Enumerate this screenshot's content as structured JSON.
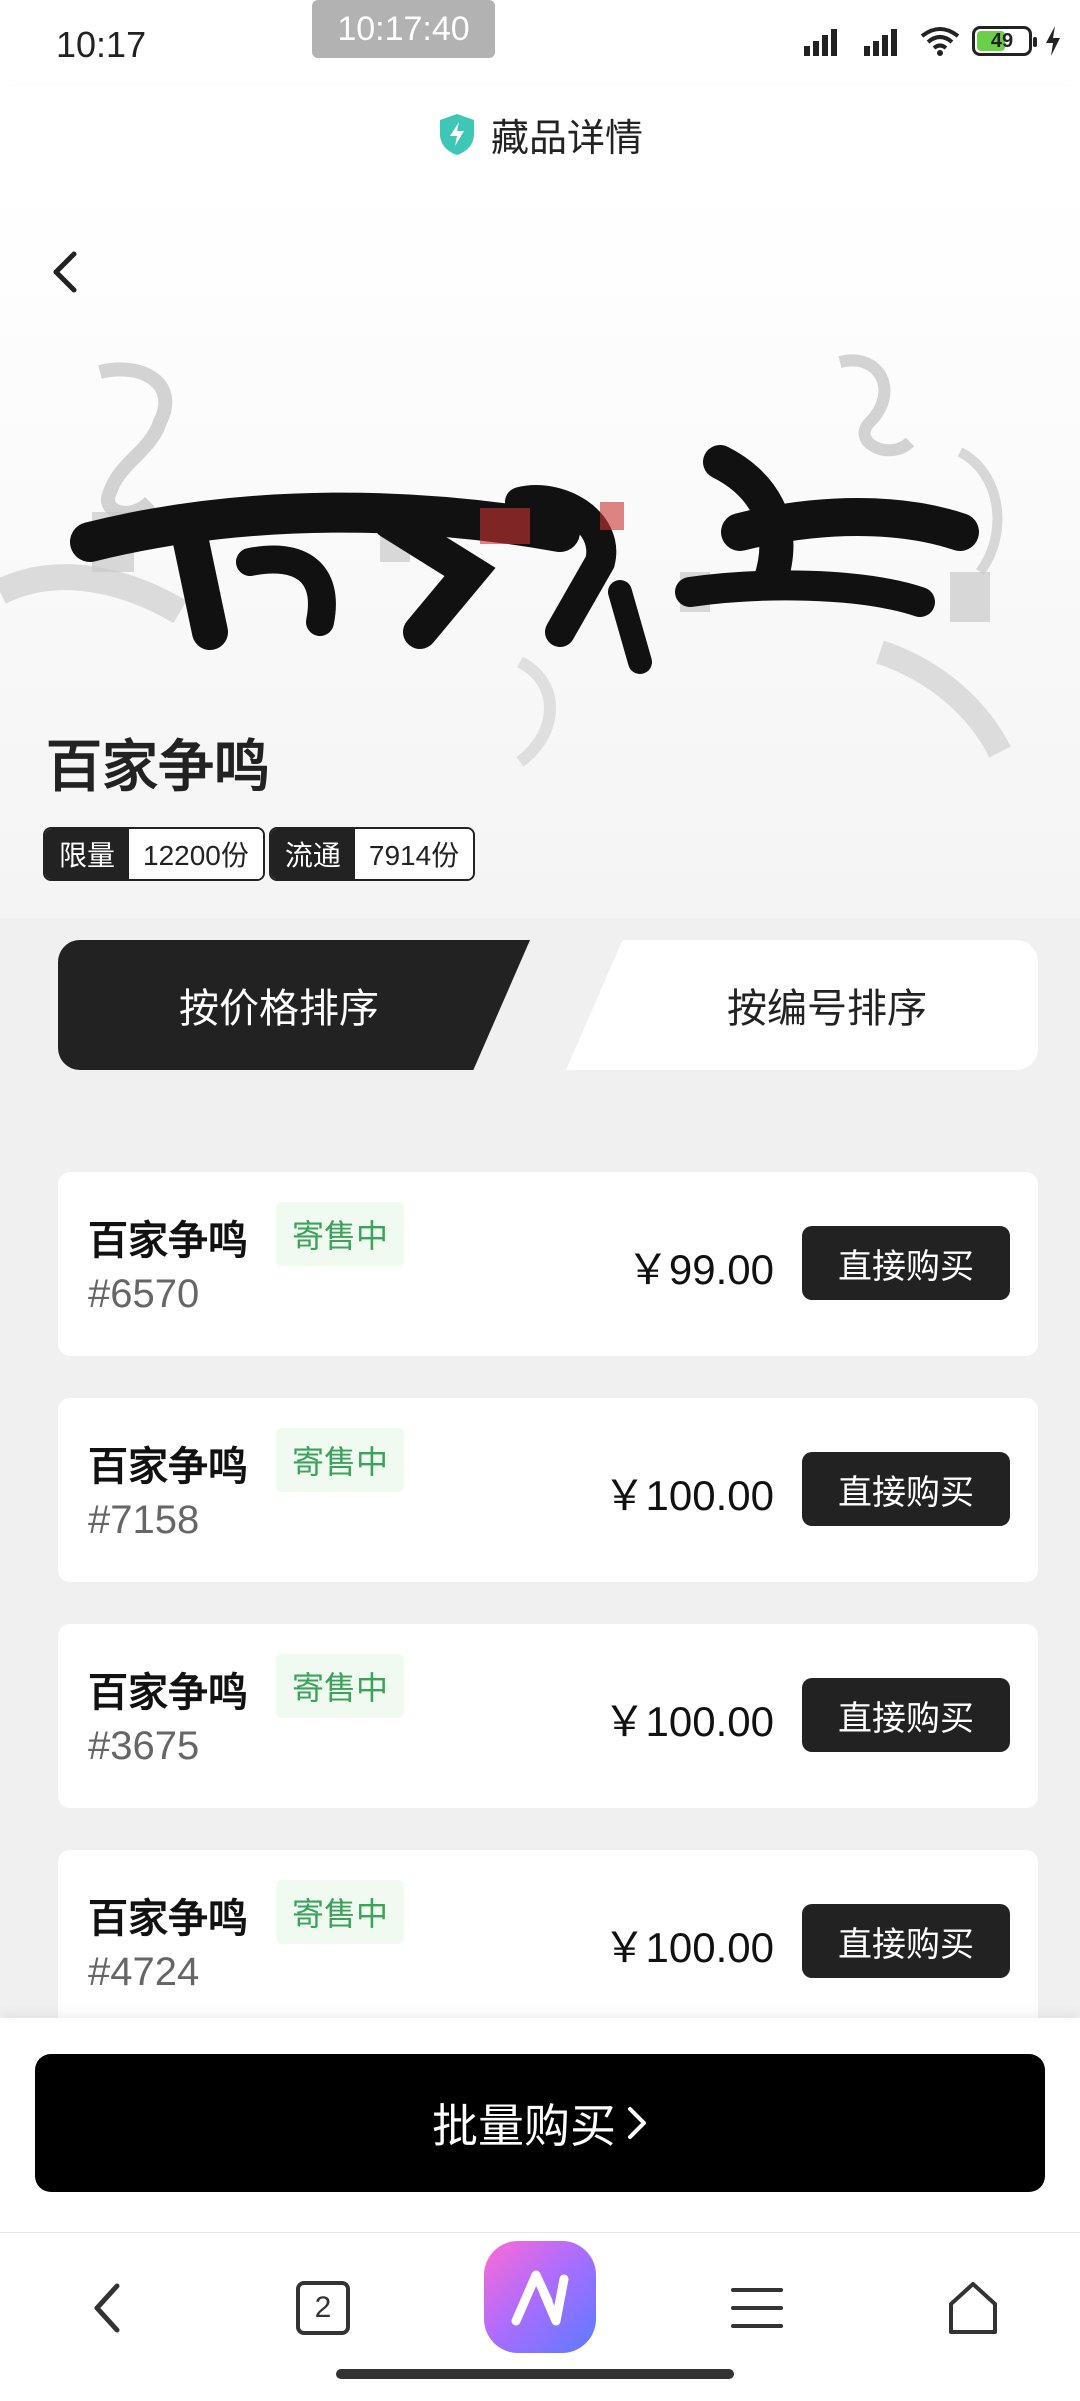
{
  "status_bar": {
    "time": "10:17",
    "toast_time": "10:17:40",
    "battery": "49"
  },
  "header": {
    "title": "藏品详情"
  },
  "collection": {
    "name": "百家争鸣",
    "limit_label": "限量",
    "limit_value": "12200份",
    "circulation_label": "流通",
    "circulation_value": "7914份"
  },
  "tabs": [
    {
      "label": "按价格排序",
      "active": true
    },
    {
      "label": "按编号排序",
      "active": false
    }
  ],
  "listings": [
    {
      "name": "百家争鸣",
      "status": "寄售中",
      "number": "#6570",
      "price": "￥99.00",
      "action": "直接购买"
    },
    {
      "name": "百家争鸣",
      "status": "寄售中",
      "number": "#7158",
      "price": "￥100.00",
      "action": "直接购买"
    },
    {
      "name": "百家争鸣",
      "status": "寄售中",
      "number": "#3675",
      "price": "￥100.00",
      "action": "直接购买"
    },
    {
      "name": "百家争鸣",
      "status": "寄售中",
      "number": "#4724",
      "price": "￥100.00",
      "action": "直接购买"
    }
  ],
  "batch_buy": {
    "label": "批量购买",
    "icon": "chevron-right-icon"
  },
  "nav": {
    "tab_count": "2"
  },
  "colors": {
    "status_green": "#3aa35a",
    "dark": "#222222",
    "shield": "#3ec6b6"
  }
}
